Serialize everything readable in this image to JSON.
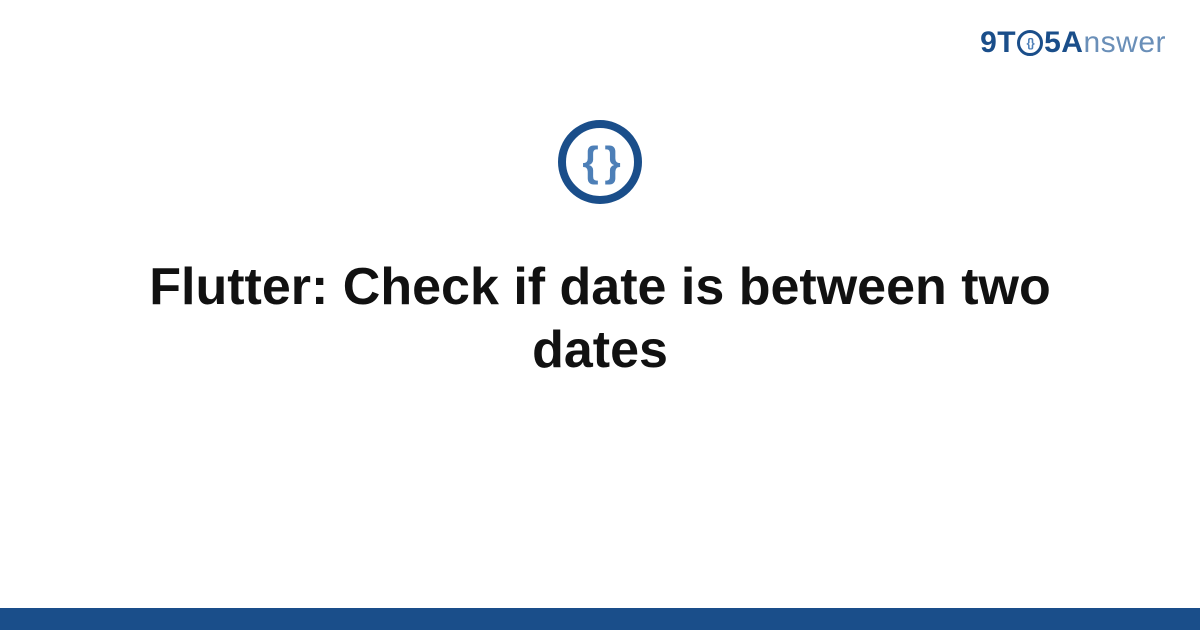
{
  "brand": {
    "part1": "9T",
    "part2": "5",
    "part3": "A",
    "part4": "nswer"
  },
  "badge": {
    "glyph": "{ }"
  },
  "title": "Flutter: Check if date is between two dates",
  "colors": {
    "primary": "#1a4e8a",
    "accent": "#4d7fb7"
  }
}
